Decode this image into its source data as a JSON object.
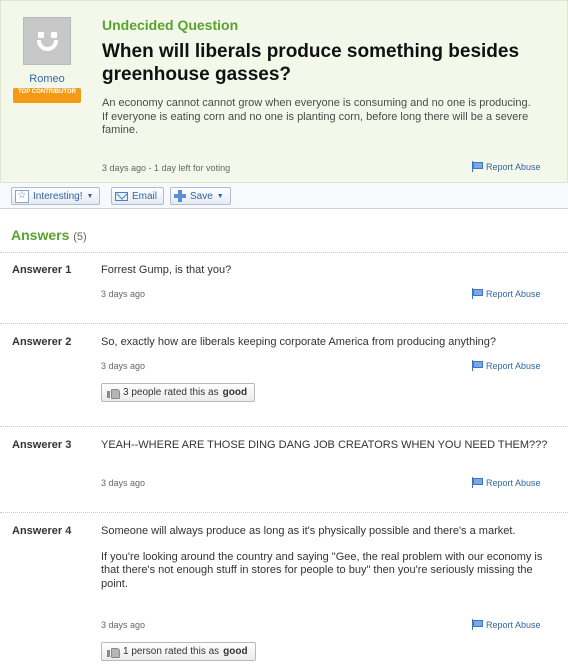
{
  "question": {
    "status": "Undecided Question",
    "asker_name": "Romeo",
    "asker_badge": "TOP CONTRIBUTOR",
    "title": "When will liberals produce something besides greenhouse gasses?",
    "body_line1": "An economy cannot cannot grow when everyone is consuming and no one is producing.",
    "body_line2": "If everyone is eating corn and no one is planting corn, before long there will be a severe famine.",
    "meta": "3 days ago - 1 day left for voting",
    "report_label": "Report Abuse"
  },
  "actions": {
    "interesting": "Interesting!",
    "email": "Email",
    "save": "Save"
  },
  "answers_section": {
    "heading": "Answers",
    "count": "(5)"
  },
  "answers": [
    {
      "name": "Answerer 1",
      "text": "Forrest Gump, is that you?",
      "meta": "3 days ago",
      "report": "Report Abuse"
    },
    {
      "name": "Answerer 2",
      "text": "So, exactly how are liberals keeping corporate America from producing anything?",
      "meta": "3 days ago",
      "report": "Report Abuse",
      "rating_prefix": "3 people rated this as",
      "rating_word": "good"
    },
    {
      "name": "Answerer 3",
      "text": "YEAH--WHERE ARE THOSE DING DANG JOB CREATORS WHEN YOU NEED THEM???",
      "meta": "3 days ago",
      "report": "Report Abuse"
    },
    {
      "name": "Answerer 4",
      "text_p1": "Someone will always produce as long as it's physically possible and there's a market.",
      "text_p2": "If you're looking around the country and saying \"Gee, the real problem with our economy is that there's not enough stuff in stores for people to buy\" then you're seriously missing the point.",
      "meta": "3 days ago",
      "report": "Report Abuse",
      "rating_prefix": "1 person rated this as",
      "rating_word": "good"
    }
  ],
  "colors": {
    "accent_green": "#58a32f",
    "link_blue": "#3366a3",
    "badge_orange": "#f59a16",
    "question_bg": "#f4f8ea"
  },
  "icons": [
    "avatar-placeholder",
    "flag-icon",
    "star-icon",
    "mail-icon",
    "plus-icon",
    "chevron-down-icon",
    "thumbs-up-icon"
  ]
}
